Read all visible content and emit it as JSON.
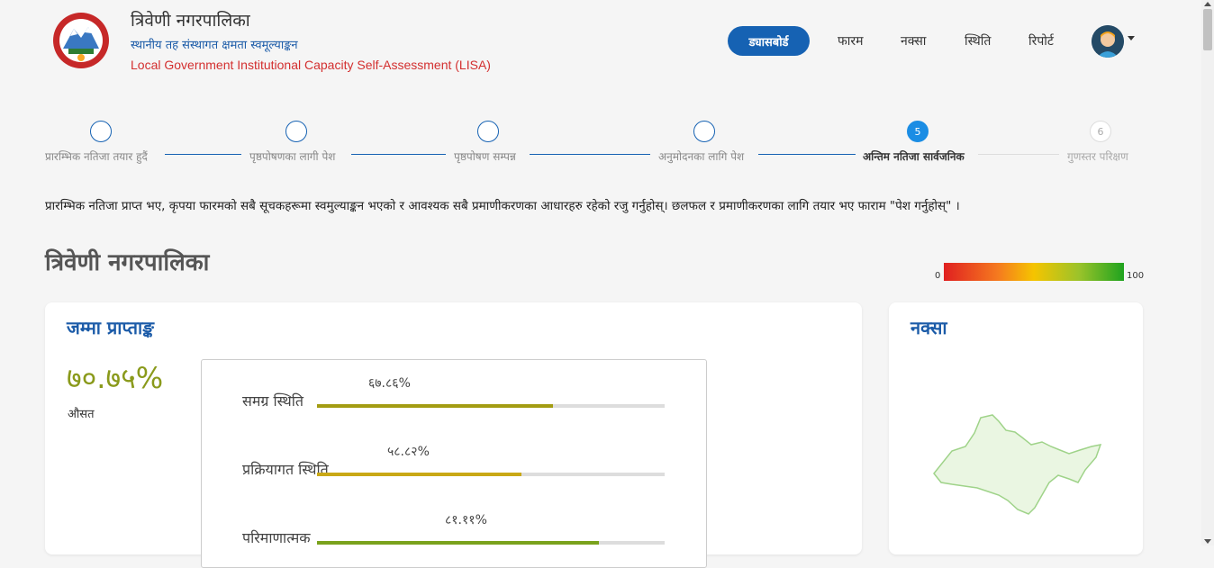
{
  "brand": {
    "title": "त्रिवेणी नगरपालिका",
    "subtitle_np": "स्थानीय तह संस्थागत क्षमता स्वमूल्याङ्कन",
    "subtitle_en": "Local Government Institutional Capacity Self-Assessment (LISA)"
  },
  "nav": {
    "dashboard": "ड्यासबोर्ड",
    "form": "फारम",
    "map": "नक्सा",
    "status": "स्थिति",
    "report": "रिपोर्ट"
  },
  "steps": [
    {
      "label": "प्रारम्भिक नतिजा तयार हुदैं",
      "number": "",
      "state": "done"
    },
    {
      "label": "पृष्ठपोषणका लागी पेश",
      "number": "",
      "state": "done"
    },
    {
      "label": "पृष्ठपोषण सम्पन्न",
      "number": "",
      "state": "done"
    },
    {
      "label": "अनुमोदनका लागि पेश",
      "number": "",
      "state": "done"
    },
    {
      "label": "अन्तिम नतिजा सार्वजनिक",
      "number": "5",
      "state": "active"
    },
    {
      "label": "गुणस्तर परिक्षण",
      "number": "6",
      "state": "pending"
    }
  ],
  "notice": "प्रारम्भिक नतिजा प्राप्त भए, कृपया फारमको सबै सूचकहरूमा स्वमुल्याङ्कन भएको र आवश्यक सबै प्रमाणीकरणका आधारहरु रहेको रजु गर्नुहोस्। छलफल र प्रमाणीकरणका लागि तयार भए फाराम \"पेश गर्नुहोस्\" ।",
  "section_title": "त्रिवेणी नगरपालिका",
  "legend": {
    "min": "0",
    "max": "100"
  },
  "score_card": {
    "title": "जम्मा प्राप्ताङ्क",
    "total": "७०.७५%",
    "avg_label": "औसत",
    "metrics": [
      {
        "label": "समग्र स्थिति",
        "value": "६७.८६%",
        "percent": 67.86,
        "color": "#a39c12"
      },
      {
        "label": "प्रक्रियागत स्थिति",
        "value": "५८.८२%",
        "percent": 58.82,
        "color": "#c9a816"
      },
      {
        "label": "परिमाणात्मक",
        "value": "८१.११%",
        "percent": 81.11,
        "color": "#7aa21c"
      }
    ]
  },
  "map_card": {
    "title": "नक्सा"
  },
  "colors": {
    "primary": "#1662b3",
    "active_step": "#1b8de4",
    "brand_red": "#d32f2f",
    "score": "#8a9a1b"
  }
}
